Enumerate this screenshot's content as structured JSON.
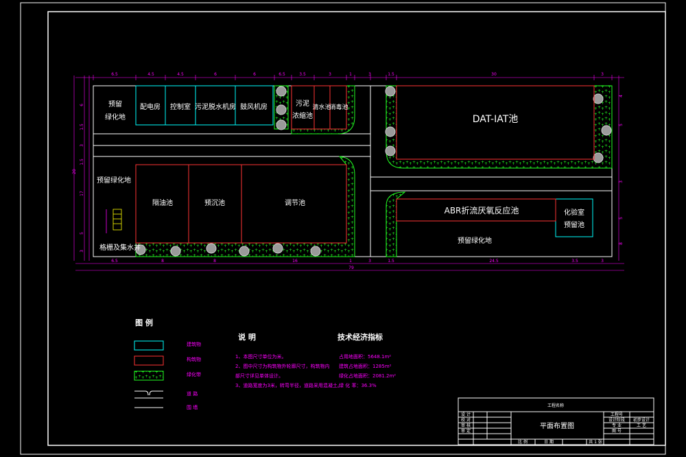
{
  "colors": {
    "background": "#000000",
    "frame": "#ffffff",
    "dimension": "#ff00ff",
    "cyan": "#00ffff",
    "red": "#ff3333",
    "green": "#22ff22",
    "grey_tree": "#b8b8b8",
    "yellow": "#ffff00"
  },
  "site": {
    "top_dims": [
      "6.5",
      "4.5",
      "4.5",
      "6",
      "6",
      "6.5",
      "3.5",
      "3",
      "1",
      "3",
      "1.5",
      "30",
      "3"
    ],
    "bottom_dims": [
      "6.5",
      "8",
      "8",
      "16",
      "1",
      "3",
      "1.5",
      "24.5",
      "3.5",
      "3"
    ],
    "total_width": "79",
    "left_dims": [
      "6",
      "1.5",
      "3",
      "1.5",
      "20",
      "17",
      "5",
      "3"
    ],
    "right_dims": [
      "4",
      "5",
      "3",
      "5",
      "8"
    ],
    "buildings": {
      "zone_green_1": "预留\n绿化地",
      "power_room": "配电房",
      "control_room": "控制室",
      "sludge_dewater": "污泥脱水机房",
      "blower_room": "鼓风机房",
      "sludge_thickener": "污泥\n浓缩池",
      "clear_water": "清水池",
      "disinfection": "消毒池",
      "dat_iat": "DAT-IAT池",
      "reserve_green_west": "预留绿化地",
      "grease_tank": "隔油池",
      "pre_settle": "预沉池",
      "equalization": "调节池",
      "abr": "ABR折流厌氧反应池",
      "lab": "化验室",
      "reserve_tank": "预留池",
      "reserve_green_south": "预留绿化地",
      "screen_pump": "格栅及集水井"
    },
    "legend_title": "图  例",
    "legend_items": [
      "建筑物",
      "构筑物",
      "绿化带",
      "道  路",
      "围  墙"
    ],
    "notes_title": "说    明",
    "notes": [
      "1、本图尺寸单位为米。",
      "2、图中尺寸为构筑物外轮廓尺寸，构筑物内",
      "    部尺寸详见单体设计。",
      "3、道路宽度为3米，转弯半径，道路采用混凝土。"
    ],
    "tech_title": "技术经济指标",
    "tech_items": [
      "占用地面积：5648.1m²",
      "建筑占地面积：1285m²",
      "绿化占地面积：2081.2m²",
      "绿  化  率：36.3%"
    ]
  },
  "title_block": {
    "project": "工程名称",
    "drawing_name": "平面布置图",
    "left_labels": [
      "设  计",
      "校  对",
      "审  核",
      "审  定"
    ],
    "right_labels": [
      "工程号",
      "设计阶段",
      "专  业",
      "图  号"
    ],
    "right_values": [
      "",
      "初步设计",
      "工  艺",
      ""
    ],
    "bottom_labels": [
      "比  例",
      "日  期",
      "共 1 张"
    ]
  }
}
